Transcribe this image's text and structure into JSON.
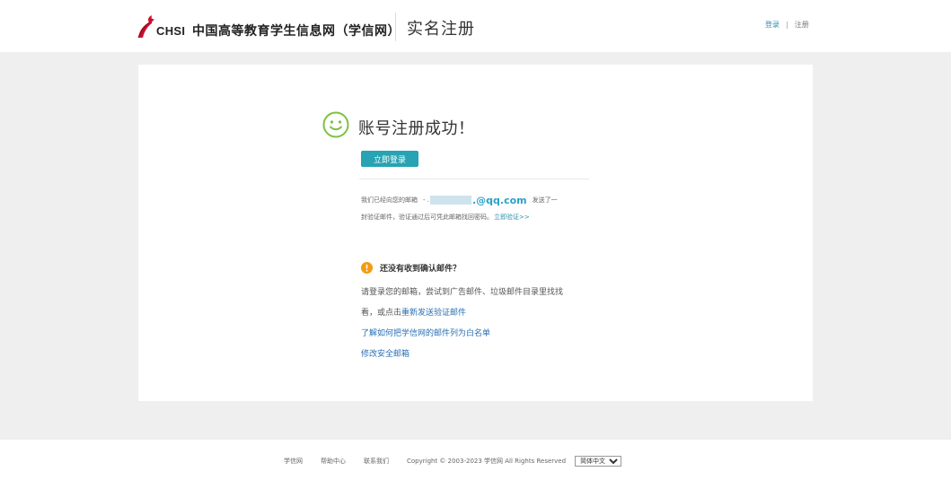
{
  "header": {
    "logo_text": "CHSI",
    "site_name": "中国高等教育学生信息网（学信网）",
    "page_title": "实名注册",
    "login_link": "登录",
    "separator": "|",
    "register_link": "注册"
  },
  "main": {
    "success_title": "账号注册成功！",
    "login_button": "立即登录",
    "message_line1_prefix": "我们已经向您的邮箱",
    "email_masked_prefix": "- .",
    "email_domain": ".@qq.com",
    "message_line1_suffix": "发送了一",
    "message_line2": "封验证邮件，验证通过后可凭此邮箱找回密码。",
    "verify_link": "立即验证>>",
    "warning_title": "还没有收到确认邮件？",
    "tip_line1": "请登录您的邮箱，尝试到广告邮件、垃圾邮件目录里找找",
    "tip_line2_prefix": "看，或点击",
    "resend_link": "重新发送验证邮件",
    "whitelist_link": "了解如何把学信网的邮件列为白名单",
    "change_email_link": "修改安全邮箱"
  },
  "footer": {
    "links": [
      "学信网",
      "帮助中心",
      "联系我们"
    ],
    "copyright": "Copyright © 2003-2023 学信网 All Rights Reserved",
    "language_selected": "简体中文"
  },
  "colors": {
    "accent_teal": "#27a3b3",
    "link_blue": "#2a6fb3",
    "smile_green": "#7cc242",
    "warning_orange": "#f39c12",
    "logo_red": "#c8102e"
  },
  "icons": {
    "logo": "chsi-bird-logo",
    "success": "smile-icon",
    "warning": "exclamation-circle-icon"
  }
}
